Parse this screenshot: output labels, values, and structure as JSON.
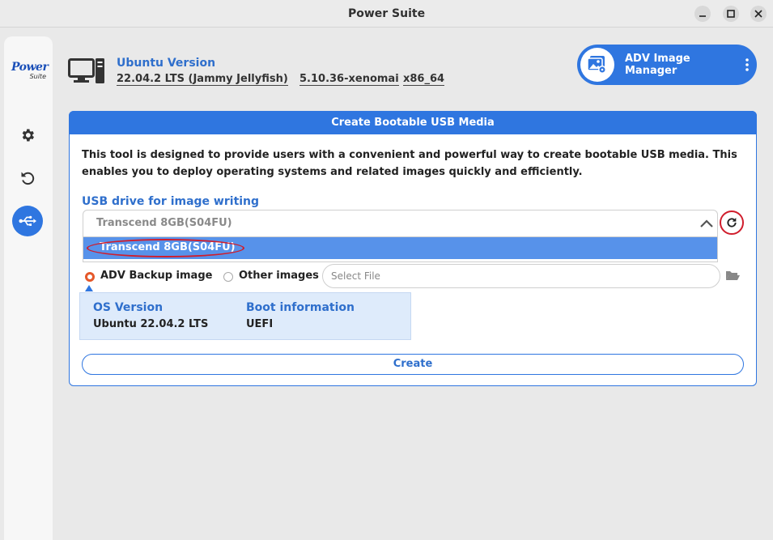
{
  "window": {
    "title": "Power Suite"
  },
  "sidebar": {
    "logo_main": "Power",
    "logo_sub": "Suite",
    "items": [
      {
        "icon": "gear-icon"
      },
      {
        "icon": "restore-icon"
      },
      {
        "icon": "usb-icon",
        "active": true
      }
    ]
  },
  "header": {
    "title": "Ubuntu Version",
    "os_release": "22.04.2 LTS (Jammy Jellyfish)",
    "kernel": "5.10.36-xenomai",
    "arch": "x86_64"
  },
  "adv_button": {
    "label": "ADV Image Manager"
  },
  "panel": {
    "title": "Create Bootable USB Media",
    "description": "This tool is designed to provide users with a convenient and powerful way to create bootable USB media. This enables you to deploy operating systems and related images quickly and efficiently.",
    "usb_label": "USB drive for image writing",
    "usb_selected": "Transcend 8GB(S04FU)",
    "usb_options": [
      "Transcend 8GB(S04FU)"
    ],
    "radio_adv": "ADV Backup image",
    "radio_other": "Other images",
    "file_placeholder": "Select File",
    "os_version_label": "OS Version",
    "os_version_value": "Ubuntu 22.04.2 LTS",
    "boot_label": "Boot information",
    "boot_value": "UEFI",
    "create_label": "Create"
  },
  "colors": {
    "accent": "#2f76e0",
    "highlight_ring": "#d01d2c",
    "radio_on": "#e5582a"
  }
}
